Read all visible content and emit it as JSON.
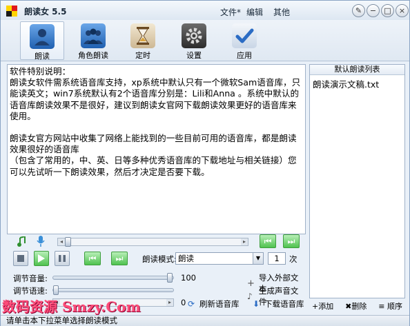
{
  "app": {
    "title": "朗读女 5.5"
  },
  "menu": {
    "file": "文件*",
    "edit": "编辑",
    "other": "其他"
  },
  "window_buttons": {
    "pin": "✎",
    "minimize": "−",
    "maximize": "□",
    "close": "×"
  },
  "toolbar": {
    "items": [
      {
        "label": "朗读",
        "icon": "person-icon",
        "active": true
      },
      {
        "label": "角色朗读",
        "icon": "group-icon",
        "active": false
      },
      {
        "label": "定时",
        "icon": "hourglass-icon",
        "active": false
      },
      {
        "label": "设置",
        "icon": "gear-icon",
        "active": false
      },
      {
        "label": "应用",
        "icon": "check-icon",
        "active": false
      }
    ]
  },
  "text_content": {
    "p1": "软件特别说明：",
    "p2": "朗读女软件需系统语音库支持，xp系统中默认只有一个微软Sam语音库，只能读英文；win7系统默认有2个语音库分别是：Lili和Anna 。系统中默认的语音库朗读效果不是很好，建议到朗读女官网下载朗读效果更好的语音库来使用。",
    "p3": "朗读女官方网站中收集了网络上能找到的一些目前可用的语音库，都是朗读效果很好的语音库",
    "p4": "（包含了常用的，中、英、日等多种优秀语音库的下载地址与相关链接）您可以先试听一下朗读效果，然后才决定是否要下载。"
  },
  "list": {
    "header": "默认朗读列表",
    "items": [
      "朗读演示文稿.txt"
    ],
    "add": "+添加",
    "delete": "✖删除",
    "order": "≡ 顺序"
  },
  "controls": {
    "mode_label": "朗读模式:",
    "mode_value": "朗读",
    "count_value": "1",
    "count_unit": "次",
    "volume_label": "调节音量:",
    "volume_value": "100",
    "speed_label": "调节语速:",
    "speed_value": "0",
    "refresh_lib": "刷新语音库",
    "import_text": "导入外部文本",
    "gen_sound": "生成声音文件",
    "download_lib": "下载语音库"
  },
  "status": {
    "text": "请单击本下拉菜单选择朗读模式"
  },
  "watermark": {
    "text": "数码资源 Smzy.Com"
  },
  "colors": {
    "accent": "#2b6cc4",
    "play_green": "#4fc24f",
    "watermark": "#ff4d7a"
  }
}
